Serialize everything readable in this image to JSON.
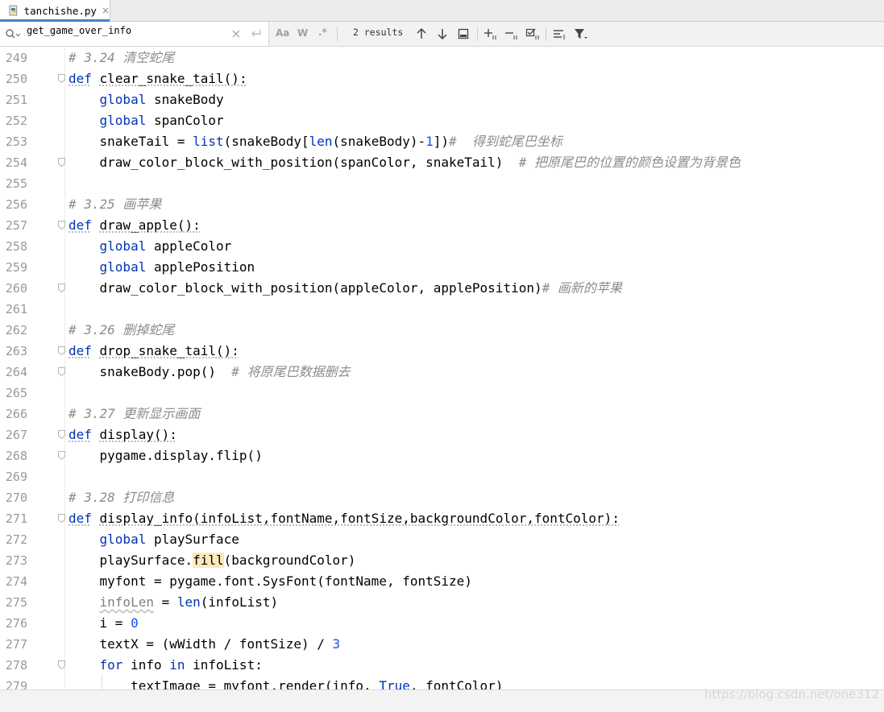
{
  "tab": {
    "filename": "tanchishe.py",
    "close_glyph": "×",
    "icon": "python-file-icon"
  },
  "search": {
    "value": "get_game_over_info",
    "results": "2 results",
    "match_case_label": "Aa",
    "words_label": "W",
    "regex_label": ".*"
  },
  "watermark": "https://blog.csdn.net/one312",
  "colors": {
    "keyword": "#0033b3",
    "comment": "#8c8c8c",
    "number": "#1750eb",
    "highlight": "#fbe9bd",
    "tab_accent": "#4083c9"
  },
  "lines": [
    {
      "no": "249",
      "tokens": [
        {
          "t": "# 3.24 清空蛇尾",
          "c": "c"
        }
      ]
    },
    {
      "no": "250",
      "fold": true,
      "tokens": [
        {
          "t": "def",
          "c": "k d"
        },
        {
          "t": " "
        },
        {
          "t": "clear_snake_tail():",
          "c": "d"
        }
      ]
    },
    {
      "no": "251",
      "tokens": [
        {
          "t": "    "
        },
        {
          "t": "global",
          "c": "k"
        },
        {
          "t": " snakeBody"
        }
      ]
    },
    {
      "no": "252",
      "tokens": [
        {
          "t": "    "
        },
        {
          "t": "global",
          "c": "k"
        },
        {
          "t": " spanColor"
        }
      ]
    },
    {
      "no": "253",
      "tokens": [
        {
          "t": "    snakeTail = "
        },
        {
          "t": "list",
          "c": "k"
        },
        {
          "t": "(snakeBody["
        },
        {
          "t": "len",
          "c": "k"
        },
        {
          "t": "(snakeBody)-"
        },
        {
          "t": "1",
          "c": "n"
        },
        {
          "t": "])"
        },
        {
          "t": "#  得到蛇尾巴坐标",
          "c": "c"
        }
      ]
    },
    {
      "no": "254",
      "fold": true,
      "tokens": [
        {
          "t": "    draw_color_block_with_position(spanColor, snakeTail)  "
        },
        {
          "t": "# 把原尾巴的位置的颜色设置为背景色",
          "c": "c"
        }
      ]
    },
    {
      "no": "255",
      "tokens": []
    },
    {
      "no": "256",
      "tokens": [
        {
          "t": "# 3.25 画苹果",
          "c": "c"
        }
      ]
    },
    {
      "no": "257",
      "fold": true,
      "tokens": [
        {
          "t": "def",
          "c": "k d"
        },
        {
          "t": " "
        },
        {
          "t": "draw_apple():",
          "c": "d"
        }
      ]
    },
    {
      "no": "258",
      "tokens": [
        {
          "t": "    "
        },
        {
          "t": "global",
          "c": "k"
        },
        {
          "t": " appleColor"
        }
      ]
    },
    {
      "no": "259",
      "tokens": [
        {
          "t": "    "
        },
        {
          "t": "global",
          "c": "k"
        },
        {
          "t": " applePosition"
        }
      ]
    },
    {
      "no": "260",
      "fold": true,
      "tokens": [
        {
          "t": "    draw_color_block_with_position(appleColor, applePosition)"
        },
        {
          "t": "# 画新的苹果",
          "c": "c"
        }
      ]
    },
    {
      "no": "261",
      "tokens": []
    },
    {
      "no": "262",
      "tokens": [
        {
          "t": "# 3.26 删掉蛇尾",
          "c": "c"
        }
      ]
    },
    {
      "no": "263",
      "fold": true,
      "tokens": [
        {
          "t": "def",
          "c": "k d"
        },
        {
          "t": " "
        },
        {
          "t": "drop_snake_tail():",
          "c": "d"
        }
      ]
    },
    {
      "no": "264",
      "fold": true,
      "tokens": [
        {
          "t": "    snakeBody.pop()  "
        },
        {
          "t": "# 将原尾巴数据删去",
          "c": "c"
        }
      ]
    },
    {
      "no": "265",
      "tokens": []
    },
    {
      "no": "266",
      "tokens": [
        {
          "t": "# 3.27 更新显示画面",
          "c": "c"
        }
      ]
    },
    {
      "no": "267",
      "fold": true,
      "tokens": [
        {
          "t": "def",
          "c": "k d"
        },
        {
          "t": " "
        },
        {
          "t": "display():",
          "c": "d"
        }
      ]
    },
    {
      "no": "268",
      "fold": true,
      "tokens": [
        {
          "t": "    pygame.display.flip()"
        }
      ]
    },
    {
      "no": "269",
      "tokens": []
    },
    {
      "no": "270",
      "tokens": [
        {
          "t": "# 3.28 打印信息",
          "c": "c"
        }
      ]
    },
    {
      "no": "271",
      "fold": true,
      "tokens": [
        {
          "t": "def",
          "c": "k d"
        },
        {
          "t": " "
        },
        {
          "t": "display_info(infoList,fontName,fontSize,backgroundColor,fontColor):",
          "c": "d"
        }
      ]
    },
    {
      "no": "272",
      "tokens": [
        {
          "t": "    "
        },
        {
          "t": "global",
          "c": "k"
        },
        {
          "t": " playSurface"
        }
      ]
    },
    {
      "no": "273",
      "tokens": [
        {
          "t": "    playSurface."
        },
        {
          "t": "fill",
          "c": "hl"
        },
        {
          "t": "(backgroundColor)"
        }
      ]
    },
    {
      "no": "274",
      "tokens": [
        {
          "t": "    myfont = pygame.font.SysFont(fontName, fontSize)"
        }
      ]
    },
    {
      "no": "275",
      "tokens": [
        {
          "t": "    "
        },
        {
          "t": "infoLen",
          "c": "u"
        },
        {
          "t": " = "
        },
        {
          "t": "len",
          "c": "k"
        },
        {
          "t": "(infoList)"
        }
      ]
    },
    {
      "no": "276",
      "tokens": [
        {
          "t": "    i = "
        },
        {
          "t": "0",
          "c": "n"
        }
      ]
    },
    {
      "no": "277",
      "tokens": [
        {
          "t": "    textX = (wWidth / fontSize) / "
        },
        {
          "t": "3",
          "c": "n"
        }
      ]
    },
    {
      "no": "278",
      "fold": true,
      "tokens": [
        {
          "t": "    "
        },
        {
          "t": "for",
          "c": "k"
        },
        {
          "t": " info "
        },
        {
          "t": "in",
          "c": "k"
        },
        {
          "t": " infoList:"
        }
      ]
    },
    {
      "no": "279",
      "tokens": [
        {
          "t": "        textImage = myfont.render(info, "
        },
        {
          "t": "True",
          "c": "k"
        },
        {
          "t": ", fontColor)"
        }
      ]
    }
  ]
}
